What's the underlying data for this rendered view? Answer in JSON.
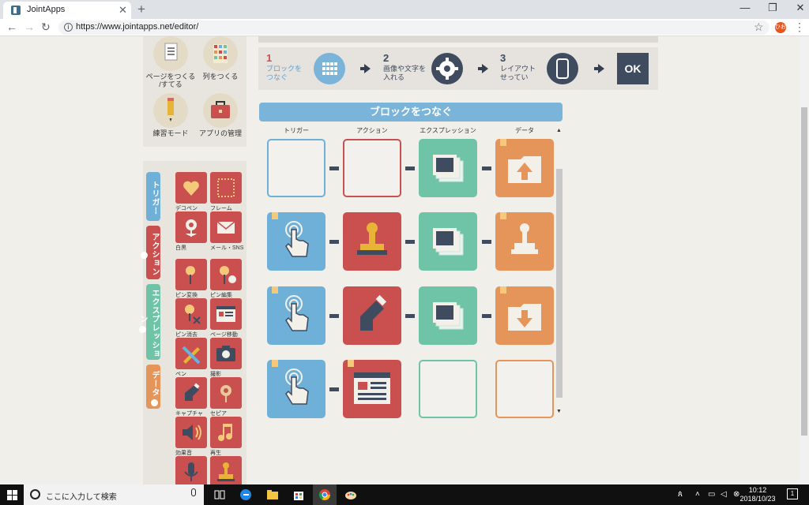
{
  "browser": {
    "tab_title": "JointApps",
    "tab_close": "✕",
    "new_tab": "+",
    "minimize": "—",
    "maximize": "❐",
    "close": "✕",
    "url": "https://www.jointapps.net/editor/",
    "profile_initials": "ひお"
  },
  "menu": {
    "items": [
      {
        "label": "ページをつくる\n/すてる"
      },
      {
        "label": "列をつくる"
      },
      {
        "label": "練習モード"
      },
      {
        "label": "アプリの管理"
      }
    ]
  },
  "palette": {
    "tabs": [
      {
        "label": "トリガー",
        "color": "#6fb0d9"
      },
      {
        "label": "アクション",
        "color": "#c9504f"
      },
      {
        "label": "エクスプレッション",
        "color": "#6fc3a7"
      },
      {
        "label": "データ",
        "color": "#e6955a"
      }
    ],
    "items": [
      {
        "label": "デコペン"
      },
      {
        "label": "フレーム"
      },
      {
        "label": "白黒"
      },
      {
        "label": "メール・SNS"
      },
      {
        "label": "ピン変換"
      },
      {
        "label": "ピン編集"
      },
      {
        "label": "ピン消去"
      },
      {
        "label": "ページ移動"
      },
      {
        "label": "ペン"
      },
      {
        "label": "撮影"
      },
      {
        "label": "キャプチャ"
      },
      {
        "label": "セピア"
      },
      {
        "label": "効果音"
      },
      {
        "label": "再生"
      },
      {
        "label": ""
      },
      {
        "label": ""
      }
    ]
  },
  "steps": [
    {
      "num": "1",
      "text": "ブロックを\nつなぐ"
    },
    {
      "num": "2",
      "text": "画像や文字を\n入れる"
    },
    {
      "num": "3",
      "text": "レイアウト\nせってい"
    }
  ],
  "ok_label": "OK",
  "section_title": "ブロックをつなぐ",
  "columns": [
    "トリガー",
    "アクション",
    "エクスプレッション",
    "データ"
  ],
  "colors": {
    "trigger": "#6fb0d9",
    "action": "#c9504f",
    "expression": "#6fc3a7",
    "data": "#e6955a",
    "dark": "#3f4b5e"
  },
  "grid": [
    [
      "empty-trigger",
      "empty-action",
      "expression-photo",
      "data-upload"
    ],
    [
      "trigger-tap",
      "action-stamp",
      "expression-photo",
      "data-stamp"
    ],
    [
      "trigger-tap",
      "action-capture",
      "expression-photo",
      "data-download"
    ],
    [
      "trigger-tap",
      "action-page",
      "empty-expression",
      "empty-data"
    ]
  ],
  "taskbar": {
    "search_placeholder": "ここに入力して検索",
    "time": "10:12",
    "date": "2018/10/23",
    "notifications": "1"
  }
}
